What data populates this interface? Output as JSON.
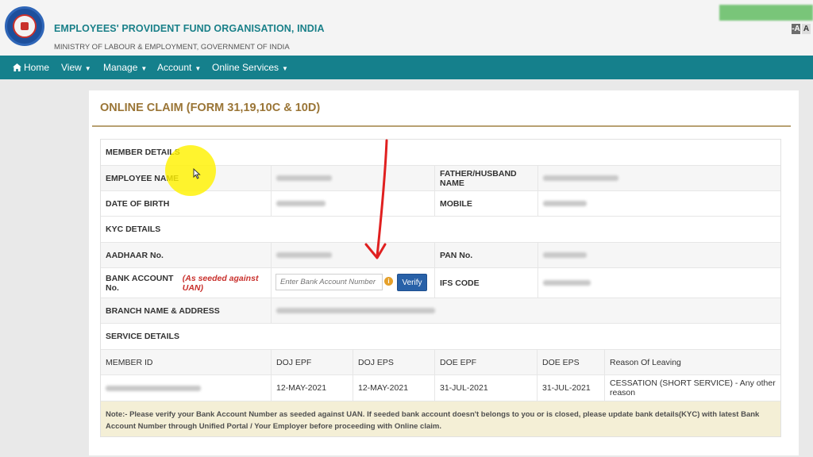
{
  "header": {
    "org_name": "EMPLOYEES' PROVIDENT FUND ORGANISATION, INDIA",
    "ministry": "MINISTRY OF LABOUR & EMPLOYMENT, GOVERNMENT OF INDIA",
    "font_controls": [
      "-A",
      "A"
    ]
  },
  "nav": {
    "items": [
      {
        "label": "Home",
        "icon": "home-icon"
      },
      {
        "label": "View"
      },
      {
        "label": "Manage"
      },
      {
        "label": "Account"
      },
      {
        "label": "Online Services"
      }
    ]
  },
  "page": {
    "title": "ONLINE CLAIM (FORM 31,19,10C & 10D)"
  },
  "member_details": {
    "heading": "MEMBER DETAILS",
    "employee_name_label": "EMPLOYEE NAME",
    "father_name_label": "FATHER/HUSBAND NAME",
    "dob_label": "DATE OF BIRTH",
    "mobile_label": "MOBILE"
  },
  "kyc_details": {
    "heading": "KYC DETAILS",
    "aadhaar_label": "AADHAAR No.",
    "pan_label": "PAN No.",
    "bank_label": "BANK ACCOUNT No.",
    "bank_note": "(As seeded against UAN)",
    "bank_placeholder": "Enter Bank Account Number",
    "verify_label": "Verify",
    "ifs_label": "IFS CODE",
    "branch_label": "BRANCH NAME & ADDRESS"
  },
  "service_details": {
    "heading": "SERVICE DETAILS",
    "columns": [
      "MEMBER ID",
      "DOJ EPF",
      "DOJ EPS",
      "DOE EPF",
      "DOE EPS",
      "Reason Of Leaving"
    ],
    "row": {
      "doj_epf": "12-MAY-2021",
      "doj_eps": "12-MAY-2021",
      "doe_epf": "31-JUL-2021",
      "doe_eps": "31-JUL-2021",
      "reason": "CESSATION (SHORT SERVICE) - Any other reason"
    }
  },
  "note": {
    "text": "Note:- Please verify your Bank Account Number as seeded against UAN. If seeded bank account doesn't belongs to you or is closed, please update bank details(KYC) with latest Bank Account Number through Unified Portal / Your Employer before proceeding with Online claim."
  },
  "colors": {
    "nav_bg": "#15808c",
    "org_name": "#1a8089",
    "title": "#9a7536",
    "verify_btn": "#2861a8",
    "note_bg": "#f4efd6",
    "annotation_arrow": "#e02020",
    "highlight": "#fff200"
  }
}
